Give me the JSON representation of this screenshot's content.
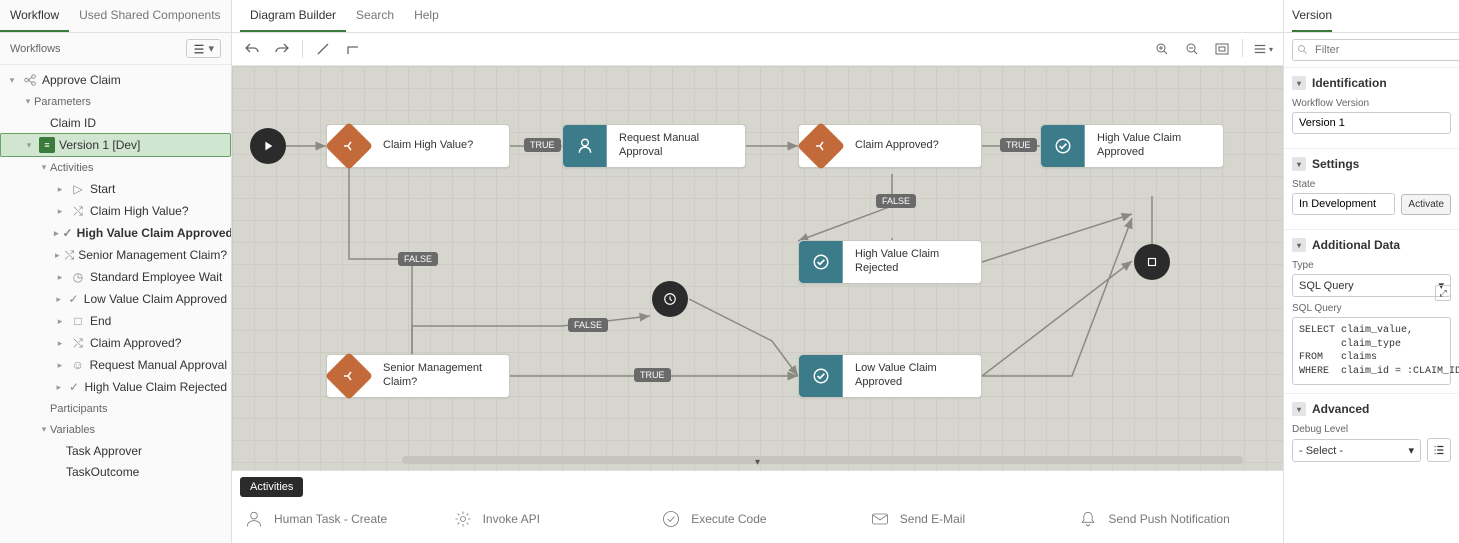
{
  "left": {
    "tab_workflow": "Workflow",
    "tab_shared": "Used Shared Components",
    "subheader": "Workflows",
    "tree": {
      "root": "Approve Claim",
      "parameters": "Parameters",
      "claim_id": "Claim ID",
      "version": "Version 1 [Dev]",
      "activities": "Activities",
      "act_start": "Start",
      "act_chv": "Claim High Value?",
      "act_hvca": "High Value Claim Approved",
      "act_smc": "Senior Management Claim?",
      "act_sew": "Standard Employee Wait",
      "act_lvca": "Low Value Claim Approved",
      "act_end": "End",
      "act_ca": "Claim Approved?",
      "act_rma": "Request Manual Approval",
      "act_hvcr": "High Value Claim Rejected",
      "participants": "Participants",
      "variables": "Variables",
      "var_ta": "Task Approver",
      "var_to": "TaskOutcome"
    }
  },
  "center": {
    "tab_diagram": "Diagram Builder",
    "tab_search": "Search",
    "tab_help": "Help",
    "nodes": {
      "chv": "Claim High Value?",
      "rma": "Request Manual\nApproval",
      "ca": "Claim Approved?",
      "hvca": "High Value Claim\nApproved",
      "hvcr": "High Value Claim\nRejected",
      "lvca": "Low Value Claim\nApproved",
      "smc": "Senior Management\nClaim?"
    },
    "labels": {
      "true": "TRUE",
      "false": "FALSE"
    },
    "footer": {
      "tag": "Activities",
      "p1": "Human Task - Create",
      "p2": "Invoke API",
      "p3": "Execute Code",
      "p4": "Send E-Mail",
      "p5": "Send Push Notification"
    }
  },
  "right": {
    "tab_version": "Version",
    "filter_placeholder": "Filter",
    "sec_identification": "Identification",
    "lbl_wf_version": "Workflow Version",
    "val_wf_version": "Version 1",
    "sec_settings": "Settings",
    "lbl_state": "State",
    "val_state": "In Development",
    "btn_activate": "Activate",
    "sec_additional": "Additional Data",
    "lbl_type": "Type",
    "val_type": "SQL Query",
    "lbl_sql": "SQL Query",
    "val_sql": "SELECT claim_value,\n       claim_type\nFROM   claims\nWHERE  claim_id = :CLAIM_ID;",
    "sec_advanced": "Advanced",
    "lbl_debug": "Debug Level",
    "val_debug": "- Select -"
  }
}
